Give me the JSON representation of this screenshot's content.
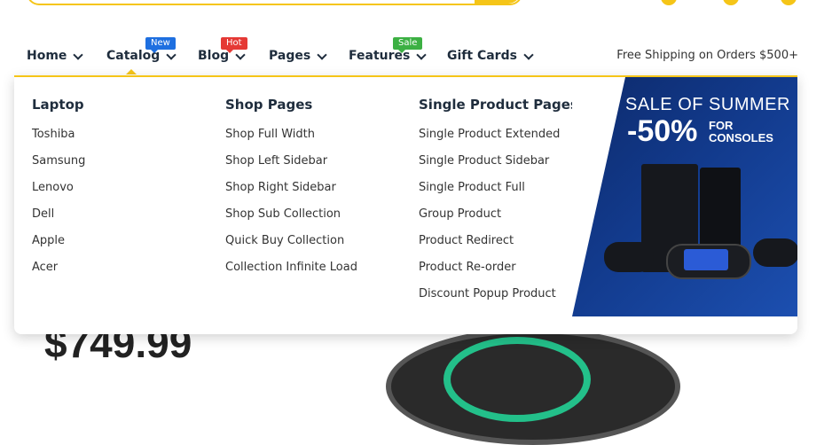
{
  "nav": {
    "items": [
      {
        "label": "Home"
      },
      {
        "label": "Catalog",
        "badge": "New",
        "badge_color": "#1e6fe0"
      },
      {
        "label": "Blog",
        "badge": "Hot",
        "badge_color": "#e53935"
      },
      {
        "label": "Pages"
      },
      {
        "label": "Features",
        "badge": "Sale",
        "badge_color": "#3cb043"
      },
      {
        "label": "Gift Cards"
      }
    ],
    "shipping_text": "Free Shipping on Orders $500+"
  },
  "mega_menu": {
    "columns": [
      {
        "heading": "Laptop",
        "links": [
          "Toshiba",
          "Samsung",
          "Lenovo",
          "Dell",
          "Apple",
          "Acer"
        ]
      },
      {
        "heading": "Shop Pages",
        "links": [
          "Shop Full Width",
          "Shop Left Sidebar",
          "Shop Right Sidebar",
          "Shop Sub Collection",
          "Quick Buy Collection",
          "Collection Infinite Load"
        ]
      },
      {
        "heading": "Single Product Pages",
        "links": [
          "Single Product Extended",
          "Single Product Sidebar",
          "Single Product Full",
          "Group Product",
          "Product Redirect",
          "Product Re-order",
          "Discount Popup Product"
        ]
      }
    ],
    "banner": {
      "title": "SALE OF SUMMER",
      "discount": "-50%",
      "for_line1": "FOR",
      "for_line2": "CONSOLES"
    }
  },
  "background": {
    "price_partial": "$749.99"
  },
  "colors": {
    "accent": "#f5c518",
    "nav_text": "#1f2d3d",
    "banner_blue": "#123a8c"
  }
}
